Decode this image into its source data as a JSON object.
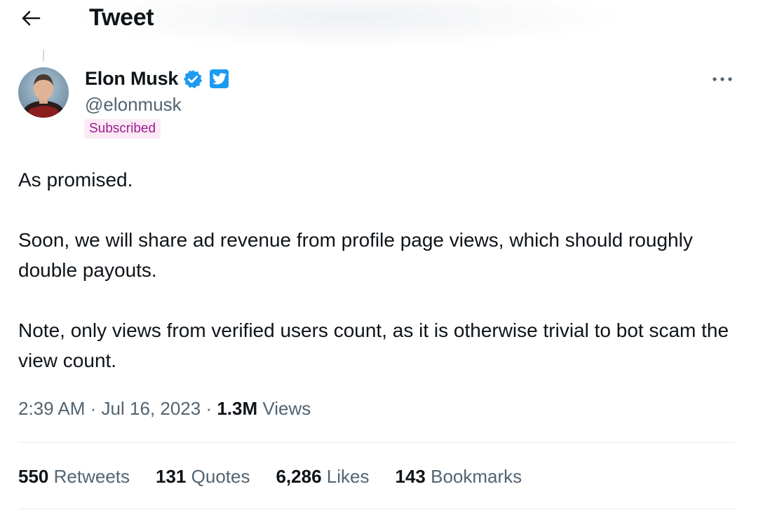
{
  "header": {
    "title": "Tweet"
  },
  "author": {
    "name": "Elon Musk",
    "handle": "@elonmusk",
    "badge": "Subscribed"
  },
  "tweet": {
    "paragraphs": [
      "As promised.",
      "Soon, we will share ad revenue from profile page views, which should roughly double payouts.",
      "Note, only views from verified users count, as it is otherwise trivial to bot scam the view count."
    ],
    "time": "2:39 AM",
    "date": "Jul 16, 2023",
    "views_count": "1.3M",
    "views_label": "Views"
  },
  "stats": [
    {
      "count": "550",
      "label": "Retweets"
    },
    {
      "count": "131",
      "label": "Quotes"
    },
    {
      "count": "6,286",
      "label": "Likes"
    },
    {
      "count": "143",
      "label": "Bookmarks"
    }
  ],
  "colors": {
    "accent": "#1d9bf0",
    "text_primary": "#0f1419",
    "text_secondary": "#536471",
    "subscribed_text": "#9b1d8f",
    "subscribed_bg": "#fbeaf5"
  },
  "icons": {
    "back": "arrow-left-icon",
    "verified": "verified-check-icon",
    "twitter": "twitter-bird-icon",
    "more": "more-horizontal-icon"
  }
}
